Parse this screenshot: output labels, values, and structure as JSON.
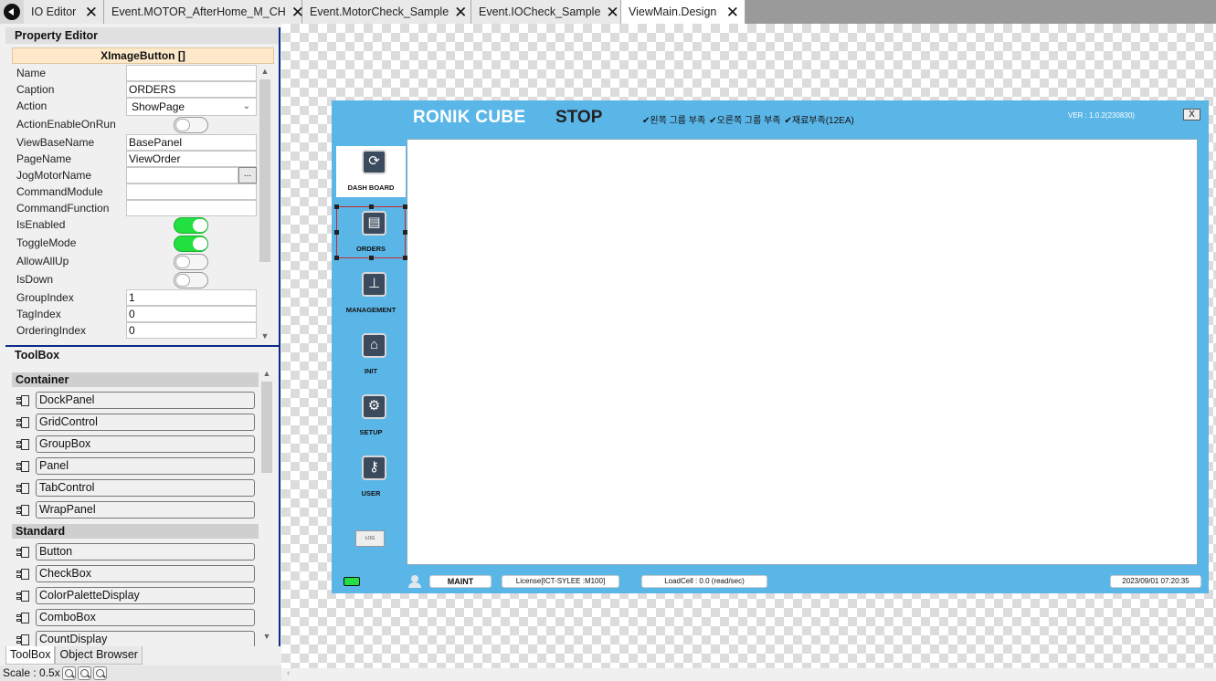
{
  "tabs": [
    {
      "label": "IO Editor"
    },
    {
      "label": "Event.MOTOR_AfterHome_M_CH"
    },
    {
      "label": "Event.MotorCheck_Sample"
    },
    {
      "label": "Event.IOCheck_Sample"
    },
    {
      "label": "ViewMain.Design"
    }
  ],
  "property_editor": {
    "header": "Property Editor",
    "object_title": "XImageButton []",
    "props": {
      "name": {
        "label": "Name",
        "value": ""
      },
      "caption": {
        "label": "Caption",
        "value": "ORDERS"
      },
      "action": {
        "label": "Action",
        "value": "ShowPage"
      },
      "action_enable_on_run": {
        "label": "ActionEnableOnRun",
        "on": false
      },
      "view_base_name": {
        "label": "ViewBaseName",
        "value": "BasePanel"
      },
      "page_name": {
        "label": "PageName",
        "value": "ViewOrder"
      },
      "jog_motor_name": {
        "label": "JogMotorName",
        "value": "",
        "button": "..."
      },
      "command_module": {
        "label": "CommandModule",
        "value": ""
      },
      "command_function": {
        "label": "CommandFunction",
        "value": ""
      },
      "is_enabled": {
        "label": "IsEnabled",
        "on": true
      },
      "toggle_mode": {
        "label": "ToggleMode",
        "on": true
      },
      "allow_all_up": {
        "label": "AllowAllUp",
        "on": false
      },
      "is_down": {
        "label": "IsDown",
        "on": false
      },
      "group_index": {
        "label": "GroupIndex",
        "value": "1"
      },
      "tag_index": {
        "label": "TagIndex",
        "value": "0"
      },
      "ordering_index": {
        "label": "OrderingIndex",
        "value": "0"
      }
    }
  },
  "toolbox": {
    "header": "ToolBox",
    "groups": [
      {
        "name": "Container",
        "items": [
          "DockPanel",
          "GridControl",
          "GroupBox",
          "Panel",
          "TabControl",
          "WrapPanel"
        ]
      },
      {
        "name": "Standard",
        "items": [
          "Button",
          "CheckBox",
          "ColorPaletteDisplay",
          "ComboBox",
          "CountDisplay"
        ]
      }
    ]
  },
  "bottom_tabs": {
    "toolbox": "ToolBox",
    "object_browser": "Object Browser"
  },
  "scale": {
    "label": "Scale : 0.5x"
  },
  "app": {
    "title": "RONIK CUBE",
    "state": "STOP",
    "warnings": [
      "왼쪽 그룹 부족",
      "오른쪽 그룹 부족",
      "재료부족(12EA)"
    ],
    "version": "VER : 1.0.2(230830)",
    "close": "X",
    "nav": [
      {
        "label": "DASH BOARD",
        "icon": "refresh-icon"
      },
      {
        "label": "ORDERS",
        "icon": "document-icon"
      },
      {
        "label": "MANAGEMENT",
        "icon": "management-icon"
      },
      {
        "label": "INIT",
        "icon": "home-icon"
      },
      {
        "label": "SETUP",
        "icon": "gear-icon"
      },
      {
        "label": "USER",
        "icon": "key-icon"
      }
    ],
    "log_button": "LOG",
    "status": {
      "mode": "MAINT",
      "license": "License[ICT-SYLEE   :M100]",
      "loadcell": "LoadCell : 0.0 (read/sec)",
      "datetime": "2023/09/01 07:20:35"
    }
  }
}
